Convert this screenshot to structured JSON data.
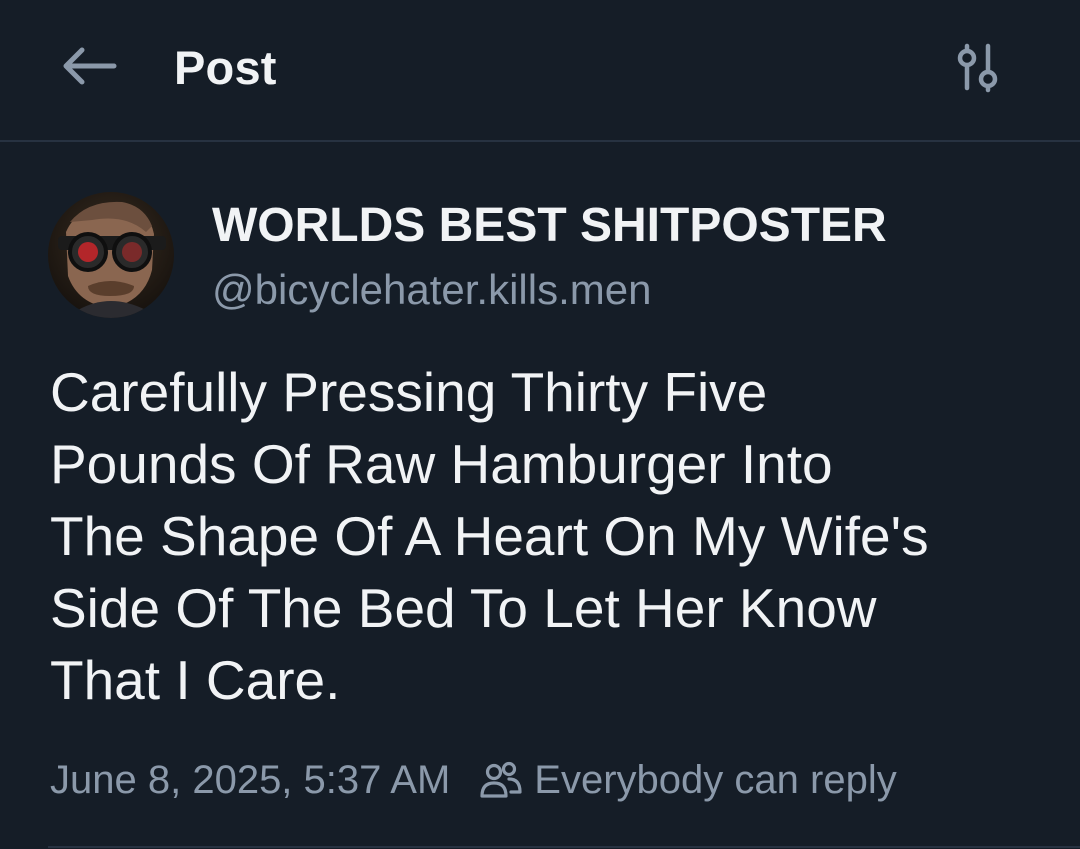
{
  "header": {
    "title": "Post",
    "back_icon": "arrow-left-icon",
    "filter_icon": "sliders-icon"
  },
  "author": {
    "display_name": "WORLDS BEST SHITPOSTER",
    "handle": "@bicyclehater.kills.men"
  },
  "post": {
    "text": "Carefully Pressing Thirty Five\nPounds Of Raw Hamburger Into\nThe Shape Of A Heart On My Wife's\nSide Of The Bed To Let Her Know\nThat I Care.",
    "timestamp": "June 8, 2025, 5:37 AM",
    "reply_setting": "Everybody can reply",
    "reply_icon": "people-icon"
  },
  "colors": {
    "background": "#151d27",
    "divider": "#273241",
    "text_primary": "#f1f3f5",
    "text_secondary": "#8b99aa"
  }
}
